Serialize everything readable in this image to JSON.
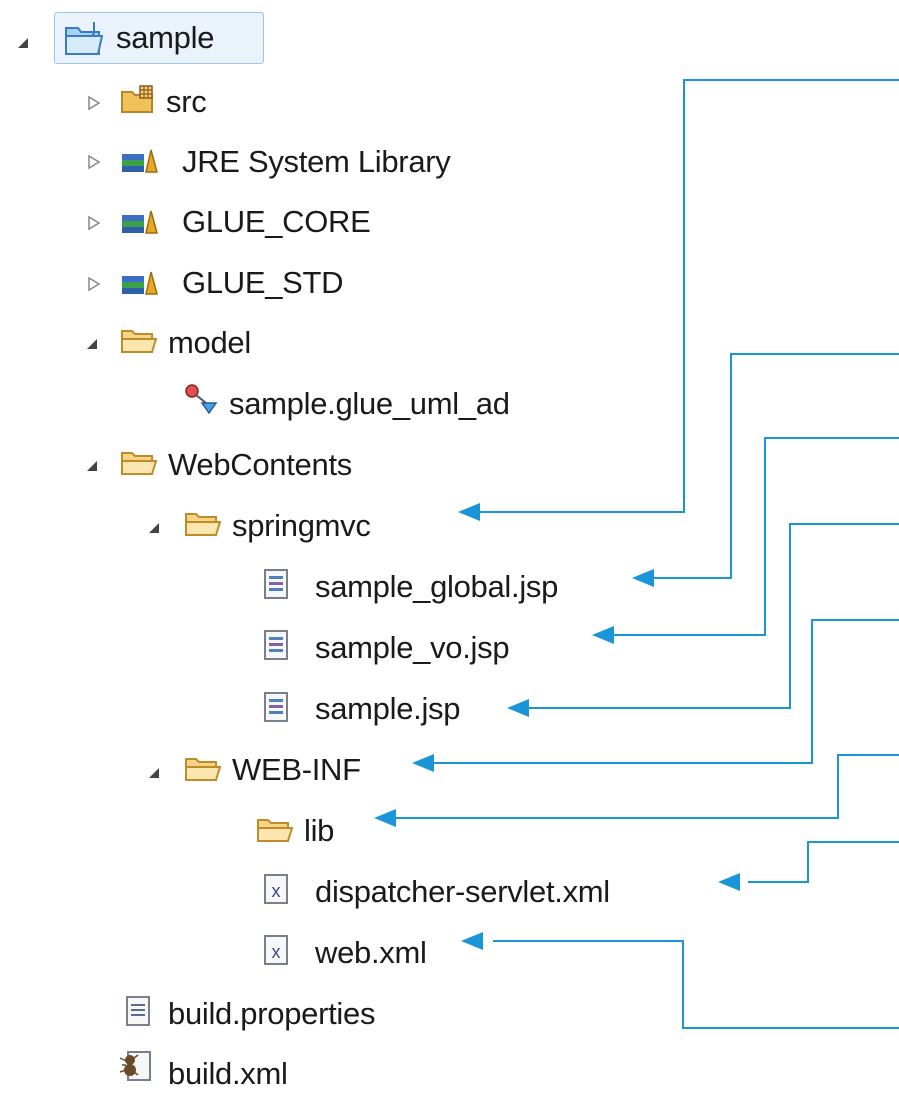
{
  "tree": {
    "root": {
      "label": "sample",
      "expanded": true
    },
    "items": [
      {
        "label": "src",
        "icon": "package-folder-icon",
        "expanded": false
      },
      {
        "label": "JRE System Library",
        "icon": "library-icon",
        "expanded": false
      },
      {
        "label": "GLUE_CORE",
        "icon": "library-icon",
        "expanded": false
      },
      {
        "label": "GLUE_STD",
        "icon": "library-icon",
        "expanded": false
      },
      {
        "label": "model",
        "icon": "folder-icon",
        "expanded": true
      },
      {
        "label": "sample.glue_uml_ad",
        "icon": "uml-file-icon"
      },
      {
        "label": "WebContents",
        "icon": "folder-icon",
        "expanded": true
      },
      {
        "label": "springmvc",
        "icon": "folder-icon",
        "expanded": true
      },
      {
        "label": "sample_global.jsp",
        "icon": "jsp-file-icon"
      },
      {
        "label": "sample_vo.jsp",
        "icon": "jsp-file-icon"
      },
      {
        "label": "sample.jsp",
        "icon": "jsp-file-icon"
      },
      {
        "label": "WEB-INF",
        "icon": "folder-icon",
        "expanded": true
      },
      {
        "label": "lib",
        "icon": "folder-icon"
      },
      {
        "label": "dispatcher-servlet.xml",
        "icon": "xml-file-icon"
      },
      {
        "label": "web.xml",
        "icon": "xml-file-icon"
      },
      {
        "label": "build.properties",
        "icon": "properties-file-icon"
      },
      {
        "label": "build.xml",
        "icon": "ant-file-icon"
      }
    ]
  },
  "colors": {
    "callout": "#1a95d8",
    "folder": "#f2c25a",
    "selection": "#eaf3fc"
  }
}
